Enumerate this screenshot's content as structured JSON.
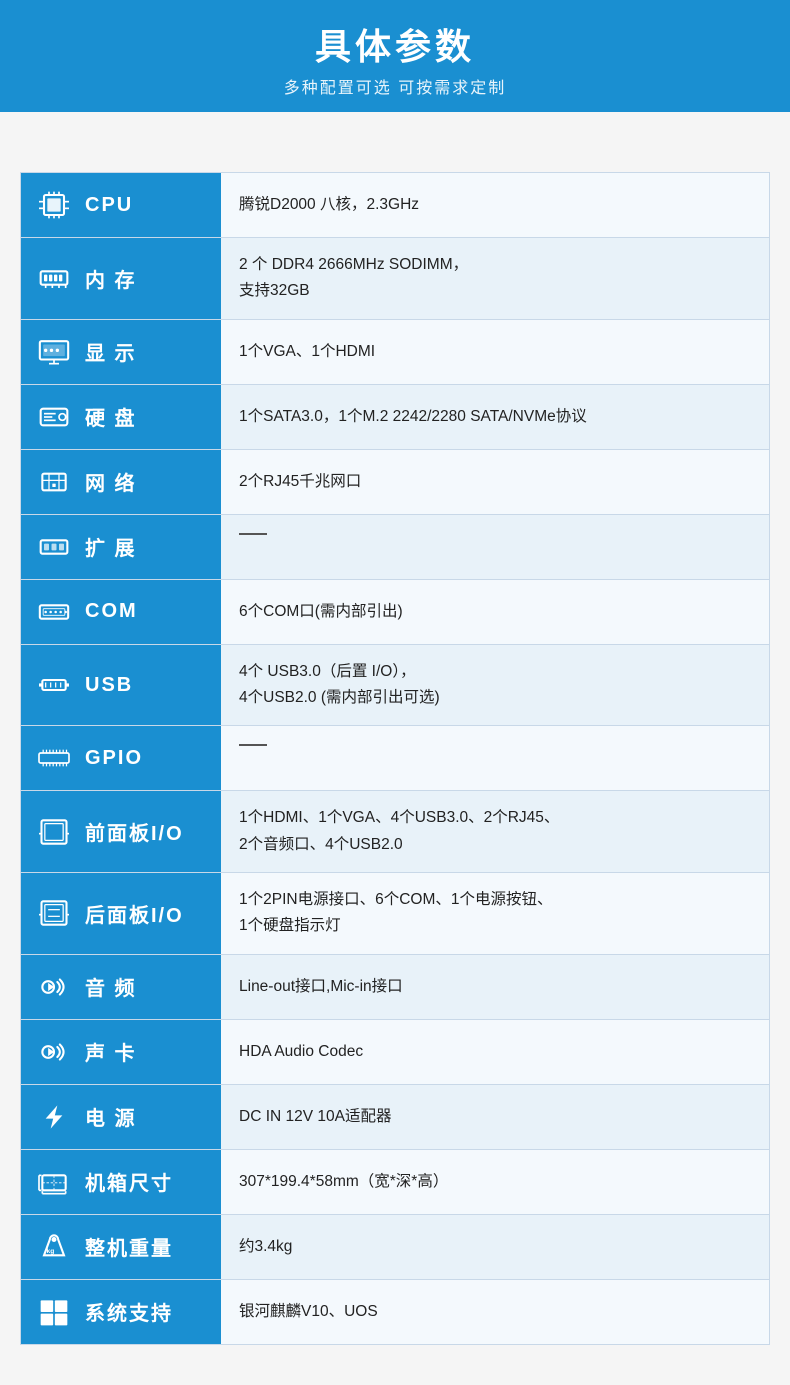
{
  "header": {
    "title": "具体参数",
    "subtitle": "多种配置可选 可按需求定制"
  },
  "rows": [
    {
      "id": "cpu",
      "label": "CPU",
      "value": "腾锐D2000 八核，2.3GHz",
      "multiline": false
    },
    {
      "id": "memory",
      "label": "内 存",
      "value": "2 个 DDR4 2666MHz SODIMM，\n支持32GB",
      "multiline": true
    },
    {
      "id": "display",
      "label": "显 示",
      "value": "1个VGA、1个HDMI",
      "multiline": false
    },
    {
      "id": "hdd",
      "label": "硬 盘",
      "value": "1个SATA3.0，1个M.2 2242/2280 SATA/NVMe协议",
      "multiline": false
    },
    {
      "id": "network",
      "label": "网 络",
      "value": "2个RJ45千兆网口",
      "multiline": false
    },
    {
      "id": "expand",
      "label": "扩 展",
      "value": "—",
      "multiline": false,
      "dash": true
    },
    {
      "id": "com",
      "label": "COM",
      "value": "6个COM口(需内部引出)",
      "multiline": false
    },
    {
      "id": "usb",
      "label": "USB",
      "value": "4个 USB3.0（后置 I/O），\n4个USB2.0 (需内部引出可选)",
      "multiline": true
    },
    {
      "id": "gpio",
      "label": "GPIO",
      "value": "—",
      "multiline": false,
      "dash": true
    },
    {
      "id": "front-io",
      "label": "前面板I/O",
      "value": "1个HDMI、1个VGA、4个USB3.0、2个RJ45、\n2个音频口、4个USB2.0",
      "multiline": true
    },
    {
      "id": "rear-io",
      "label": "后面板I/O",
      "value": "1个2PIN电源接口、6个COM、1个电源按钮、\n1个硬盘指示灯",
      "multiline": true
    },
    {
      "id": "audio",
      "label": "音 频",
      "value": "Line-out接口,Mic-in接口",
      "multiline": false
    },
    {
      "id": "sound-card",
      "label": "声 卡",
      "value": "HDA Audio Codec",
      "multiline": false
    },
    {
      "id": "power",
      "label": "电 源",
      "value": "DC IN 12V 10A适配器",
      "multiline": false
    },
    {
      "id": "dimensions",
      "label": "机箱尺寸",
      "value": "307*199.4*58mm（宽*深*高）",
      "multiline": false
    },
    {
      "id": "weight",
      "label": "整机重量",
      "value": "约3.4kg",
      "multiline": false
    },
    {
      "id": "os",
      "label": "系统支持",
      "value": "银河麒麟V10、UOS",
      "multiline": false
    }
  ]
}
